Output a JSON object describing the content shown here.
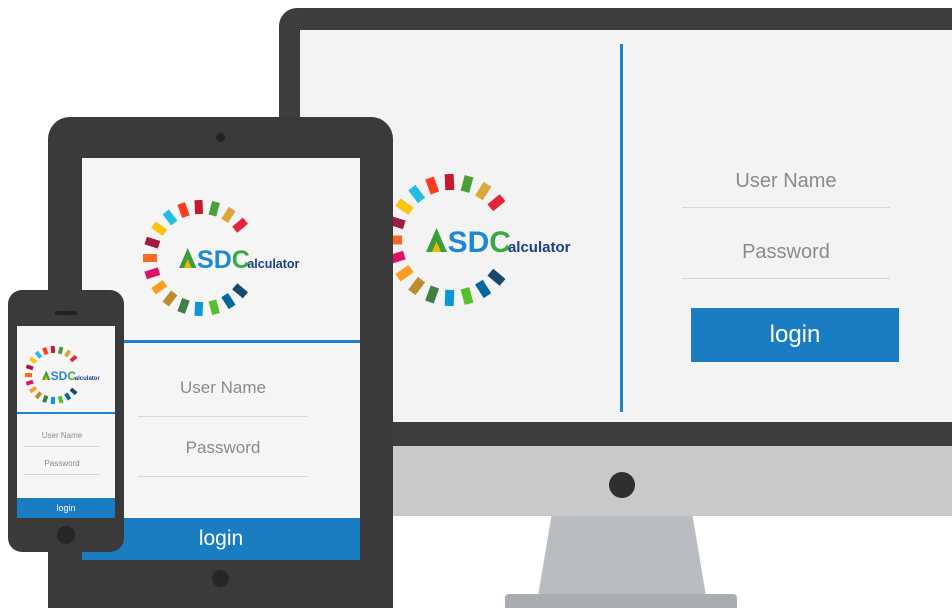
{
  "desktop": {
    "username_placeholder": "User Name",
    "password_placeholder": "Password",
    "login_label": "login"
  },
  "tablet": {
    "username_placeholder": "User Name",
    "password_placeholder": "Password",
    "login_label": "login"
  },
  "phone": {
    "username_placeholder": "User Name",
    "password_placeholder": "Password",
    "login_label": "login"
  },
  "logo": {
    "sdc_text": "SDC",
    "suffix_text": "alculator",
    "wordmark": "ASDCalculator"
  },
  "colors": {
    "accent": "#1a7cc1",
    "divider": "#1f82c9",
    "device_dark": "#3a3a3a",
    "monitor_chin": "#c9c9c9",
    "ring": [
      "#e5243b",
      "#dda63a",
      "#4c9f38",
      "#c5192d",
      "#ff3a21",
      "#26bde2",
      "#fcc30b",
      "#a21942",
      "#fd6925",
      "#dd1367",
      "#fd9d24",
      "#bf8b2e",
      "#3f7e44",
      "#0a97d9",
      "#56c02b",
      "#00689d",
      "#19486a"
    ]
  }
}
